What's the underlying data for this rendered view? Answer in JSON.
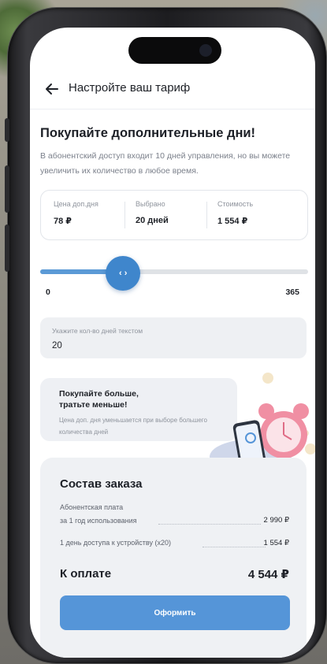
{
  "header": {
    "title": "Настройте ваш тариф"
  },
  "intro": {
    "heading": "Покупайте дополнительные дни!",
    "text": "В абонентский доступ входит 10 дней управления, но вы можете увеличить их количество в любое время."
  },
  "stats": [
    {
      "label": "Цена доп.дня",
      "value": "78 ₽"
    },
    {
      "label": "Выбрано",
      "value": "20 дней"
    },
    {
      "label": "Стоимость",
      "value": "1 554 ₽"
    }
  ],
  "slider": {
    "min_label": "0",
    "max_label": "365",
    "min": 0,
    "max": 365,
    "value": 113,
    "thumb_glyph": "‹ ›"
  },
  "days_input": {
    "label": "Укажите кол-во дней текстом",
    "value": "20"
  },
  "promo": {
    "title": "Покупайте больше, тратьте меньше!",
    "text": "Цена доп. дня уменьшается при выборе большего количества дней"
  },
  "order": {
    "title": "Состав заказа",
    "items": [
      {
        "label_line1": "Абонентская плата",
        "label_line2": "за 1 год использования",
        "price": "2 990 ₽"
      },
      {
        "label_line1": "1 день доступа к устройству (x20)",
        "price": "1 554 ₽"
      }
    ],
    "total_label": "К оплате",
    "total_value": "4 544 ₽",
    "submit_label": "Оформить"
  },
  "colors": {
    "accent": "#3f86cc",
    "button": "#5595d8"
  }
}
